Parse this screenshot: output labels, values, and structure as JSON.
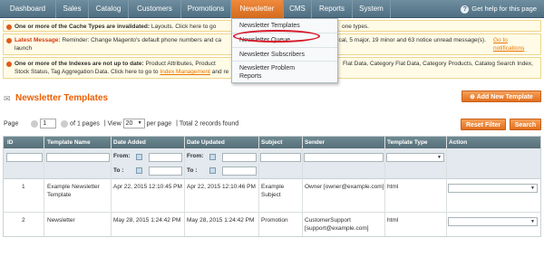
{
  "nav": {
    "items": [
      "Dashboard",
      "Sales",
      "Catalog",
      "Customers",
      "Promotions",
      "Newsletter",
      "CMS",
      "Reports",
      "System"
    ],
    "help": "Get help for this page"
  },
  "messages": [
    {
      "label": "One or more of the Cache Types are invalidated:",
      "text": "Layouts. Click here to go",
      "trail": "one types."
    },
    {
      "label": "Latest Message:",
      "text": "Reminder: Change Magento's default phone numbers and ca",
      "trail": "ical, 5 major, 19 minor and 63 notice unread message(s).",
      "link": "Go to notifications",
      "text2": "launch"
    },
    {
      "label": "One or more of the Indexes are not up to date:",
      "text": "Product Attributes, Product",
      "trail": "Flat Data, Category Flat Data, Category Products, Catalog Search Index,",
      "text2": "Stock Status, Tag Aggregation Data. Click here to go to",
      "link": "Index Management",
      "text3": "and re"
    }
  ],
  "dropdown": {
    "items": [
      "Newsletter Templates",
      "Newsletter Queue",
      "Newsletter Subscribers",
      "Newsletter Problem Reports"
    ]
  },
  "header": {
    "title": "Newsletter Templates",
    "add_button": "Add New Template"
  },
  "pager": {
    "page_label": "Page",
    "page_value": "1",
    "of_pages": "of 1 pages",
    "view_label": "View",
    "view_value": "20",
    "per_page": "per page",
    "total": "Total 2 records found",
    "reset": "Reset Filter",
    "search": "Search"
  },
  "grid": {
    "columns": [
      "ID",
      "Template Name",
      "Date Added",
      "Date Updated",
      "Subject",
      "Sender",
      "Template Type",
      "Action"
    ],
    "filter_from": "From:",
    "filter_to": "To :",
    "rows": [
      {
        "id": "1",
        "name": "Example Newsletter Template",
        "added": "Apr 22, 2015 12:10:45 PM",
        "updated": "Apr 22, 2015 12:10:46 PM",
        "subject": "Example Subject",
        "sender": "Owner [owner@example.com]",
        "type": "html"
      },
      {
        "id": "2",
        "name": "Newsletter",
        "added": "May 28, 2015 1:24:42 PM",
        "updated": "May 28, 2015 1:24:42 PM",
        "subject": "Promotion",
        "sender": "CustomerSupport [support@example.com]",
        "type": "html"
      }
    ]
  }
}
